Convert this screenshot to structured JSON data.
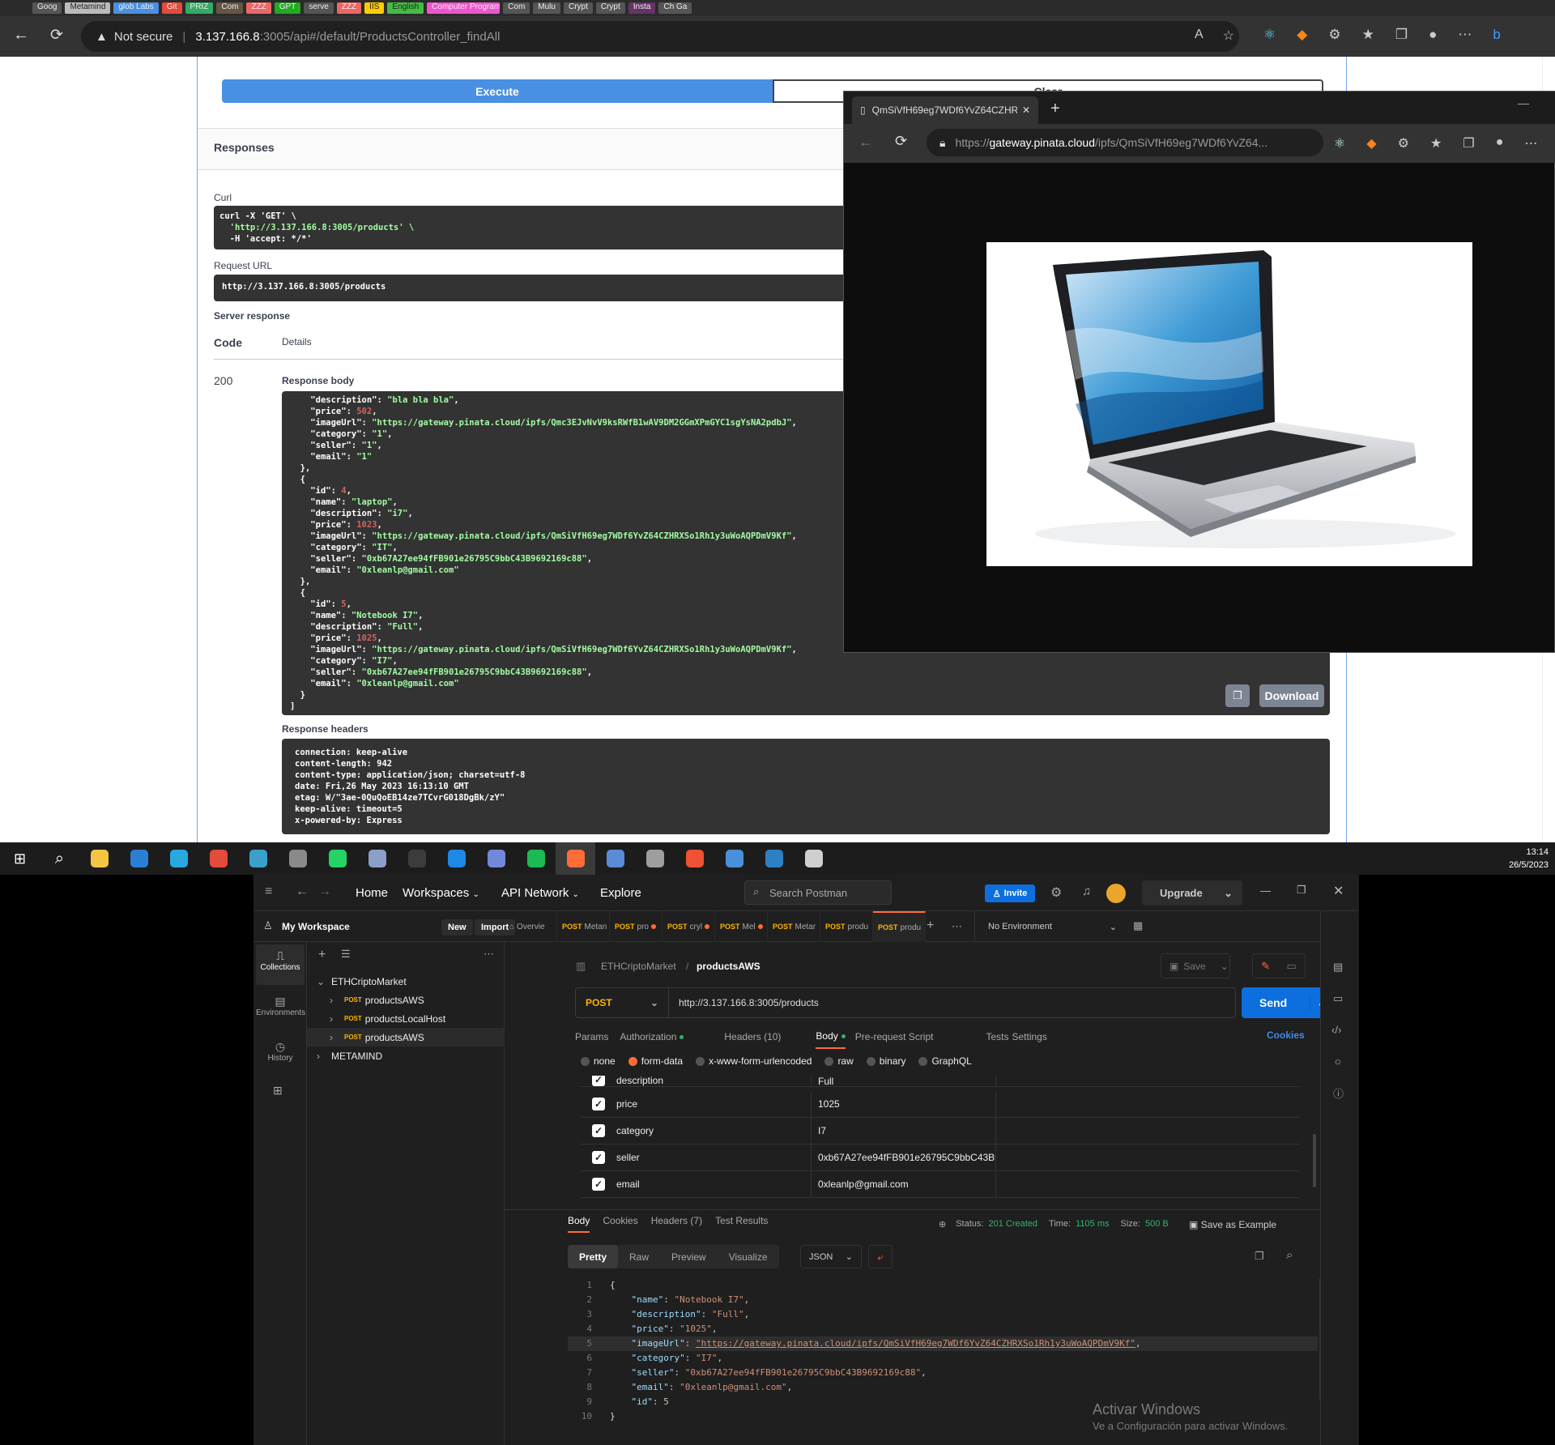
{
  "browser": {
    "tabs": [
      "Goog",
      "Metamind",
      "glob Labs",
      "Git",
      "PRIZ",
      "Com",
      "ZZZ",
      "GPT",
      "serve",
      "ZZZ",
      "IIS",
      "English",
      "Computer Program",
      "Com",
      "Mulu",
      "Crypt",
      "Crypt",
      "Insta",
      "Ch Ga"
    ],
    "not_secure": "Not secure",
    "url_host": "3.137.166.8",
    "url_rest": ":3005/api#/default/ProductsController_findAll"
  },
  "swagger": {
    "execute": "Execute",
    "clear": "Clear",
    "responses": "Responses",
    "curl_label": "Curl",
    "curl_lines": [
      "curl -X 'GET' \\",
      "  'http://3.137.166.8:3005/products' \\",
      "  -H 'accept: */*'"
    ],
    "request_url_label": "Request URL",
    "request_url": "http://3.137.166.8:3005/products",
    "server_response": "Server response",
    "code_hdr": "Code",
    "details_hdr": "Details",
    "code": "200",
    "response_body_label": "Response body",
    "body_lines": [
      [
        "    ",
        [
          "k",
          "\"description\""
        ],
        ": ",
        [
          "s",
          "\"bla bla bla\""
        ],
        ","
      ],
      [
        "    ",
        [
          "k",
          "\"price\""
        ],
        ": ",
        [
          "n",
          "502"
        ],
        ","
      ],
      [
        "    ",
        [
          "k",
          "\"imageUrl\""
        ],
        ": ",
        [
          "s",
          "\"https://gateway.pinata.cloud/ipfs/Qmc3EJvNvV9ksRWfB1wAV9DM2GGmXPmGYC1sgYsNA2pdbJ\""
        ],
        ","
      ],
      [
        "    ",
        [
          "k",
          "\"category\""
        ],
        ": ",
        [
          "s",
          "\"1\""
        ],
        ","
      ],
      [
        "    ",
        [
          "k",
          "\"seller\""
        ],
        ": ",
        [
          "s",
          "\"1\""
        ],
        ","
      ],
      [
        "    ",
        [
          "k",
          "\"email\""
        ],
        ": ",
        [
          "s",
          "\"1\""
        ]
      ],
      [
        "  },"
      ],
      [
        "  {"
      ],
      [
        "    ",
        [
          "k",
          "\"id\""
        ],
        ": ",
        [
          "n",
          "4"
        ],
        ","
      ],
      [
        "    ",
        [
          "k",
          "\"name\""
        ],
        ": ",
        [
          "s",
          "\"laptop\""
        ],
        ","
      ],
      [
        "    ",
        [
          "k",
          "\"description\""
        ],
        ": ",
        [
          "s",
          "\"i7\""
        ],
        ","
      ],
      [
        "    ",
        [
          "k",
          "\"price\""
        ],
        ": ",
        [
          "n",
          "1023"
        ],
        ","
      ],
      [
        "    ",
        [
          "k",
          "\"imageUrl\""
        ],
        ": ",
        [
          "s",
          "\"https://gateway.pinata.cloud/ipfs/QmSiVfH69eg7WDf6YvZ64CZHRXSo1Rh1y3uWoAQPDmV9Kf\""
        ],
        ","
      ],
      [
        "    ",
        [
          "k",
          "\"category\""
        ],
        ": ",
        [
          "s",
          "\"IT\""
        ],
        ","
      ],
      [
        "    ",
        [
          "k",
          "\"seller\""
        ],
        ": ",
        [
          "s",
          "\"0xb67A27ee94fFB901e26795C9bbC43B9692169c88\""
        ],
        ","
      ],
      [
        "    ",
        [
          "k",
          "\"email\""
        ],
        ": ",
        [
          "s",
          "\"0xleanlp@gmail.com\""
        ]
      ],
      [
        "  },"
      ],
      [
        "  {"
      ],
      [
        "    ",
        [
          "k",
          "\"id\""
        ],
        ": ",
        [
          "n",
          "5"
        ],
        ","
      ],
      [
        "    ",
        [
          "k",
          "\"name\""
        ],
        ": ",
        [
          "s",
          "\"Notebook I7\""
        ],
        ","
      ],
      [
        "    ",
        [
          "k",
          "\"description\""
        ],
        ": ",
        [
          "s",
          "\"Full\""
        ],
        ","
      ],
      [
        "    ",
        [
          "k",
          "\"price\""
        ],
        ": ",
        [
          "n",
          "1025"
        ],
        ","
      ],
      [
        "    ",
        [
          "k",
          "\"imageUrl\""
        ],
        ": ",
        [
          "s",
          "\"https://gateway.pinata.cloud/ipfs/QmSiVfH69eg7WDf6YvZ64CZHRXSo1Rh1y3uWoAQPDmV9Kf\""
        ],
        ","
      ],
      [
        "    ",
        [
          "k",
          "\"category\""
        ],
        ": ",
        [
          "s",
          "\"I7\""
        ],
        ","
      ],
      [
        "    ",
        [
          "k",
          "\"seller\""
        ],
        ": ",
        [
          "s",
          "\"0xb67A27ee94fFB901e26795C9bbC43B9692169c88\""
        ],
        ","
      ],
      [
        "    ",
        [
          "k",
          "\"email\""
        ],
        ": ",
        [
          "s",
          "\"0xleanlp@gmail.com\""
        ]
      ],
      [
        "  }"
      ],
      [
        "]"
      ]
    ],
    "download": "Download",
    "response_headers_label": "Response headers",
    "headers_lines": [
      "connection: keep-alive",
      "content-length: 942",
      "content-type: application/json; charset=utf-8",
      "date: Fri,26 May 2023 16:13:10 GMT",
      "etag: W/\"3ae-0QuQoEB14ze7TCvrG018DgBk/zY\"",
      "keep-alive: timeout=5",
      "x-powered-by: Express"
    ]
  },
  "pinata": {
    "tab_title": "QmSiVfH69eg7WDf6YvZ64CZHR",
    "url_prefix": "https://",
    "url_host": "gateway.pinata.cloud",
    "url_rest": "/ipfs/QmSiVfH69eg7WDf6YvZ64..."
  },
  "taskbar": {
    "time": "13:14",
    "date": "26/5/2023",
    "icons": [
      "#f4c542",
      "#2a7fd4",
      "#2aa8e0",
      "#e34b3b",
      "#3aa0c9",
      "#8a8a8a",
      "#25d366",
      "#8aa0c8",
      "#3c3c3c",
      "#1e88e5",
      "#7289da",
      "#1db954",
      "#ff6c37",
      "#5b8bd6",
      "#9e9e9e",
      "#f05033",
      "#4a90d9",
      "#2f80c2",
      "#cfcfcf"
    ]
  },
  "postman": {
    "nav": {
      "home": "Home",
      "workspaces": "Workspaces",
      "api_network": "API Network",
      "explore": "Explore",
      "search": "Search Postman",
      "invite": "Invite",
      "upgrade": "Upgrade"
    },
    "workspace": "My Workspace",
    "new": "New",
    "import": "Import",
    "sidebar": [
      "Collections",
      "Environments",
      "History"
    ],
    "tree": {
      "root": "ETHCriptoMarket",
      "items": [
        "productsAWS",
        "productsLocalHost",
        "productsAWS"
      ],
      "other": "METAMIND",
      "method": "POST"
    },
    "tabs": [
      [
        "",
        "Overvie"
      ],
      [
        "POST",
        "Metan"
      ],
      [
        "POST",
        "pro"
      ],
      [
        "POST",
        "cryl"
      ],
      [
        "POST",
        "Mel"
      ],
      [
        "POST",
        "Metar"
      ],
      [
        "POST",
        "produ"
      ],
      [
        "POST",
        "produ"
      ]
    ],
    "env": "No Environment",
    "breadcrumb": {
      "collection": "ETHCriptoMarket",
      "sep": "/",
      "request": "productsAWS"
    },
    "save": "Save",
    "method": "POST",
    "url": "http://3.137.166.8:3005/products",
    "send": "Send",
    "req_tabs": [
      "Params",
      "Authorization",
      "Headers (10)",
      "Body",
      "Pre-request Script",
      "Tests",
      "Settings"
    ],
    "cookies": "Cookies",
    "body_types": [
      "none",
      "form-data",
      "x-www-form-urlencoded",
      "raw",
      "binary",
      "GraphQL"
    ],
    "form_rows": [
      [
        "description",
        "Full"
      ],
      [
        "price",
        "1025"
      ],
      [
        "category",
        "I7"
      ],
      [
        "seller",
        "0xb67A27ee94fFB901e26795C9bbC43B969..."
      ],
      [
        "email",
        "0xleanlp@gmail.com"
      ]
    ],
    "resp_tabs": [
      "Body",
      "Cookies",
      "Headers (7)",
      "Test Results"
    ],
    "status_label": "Status:",
    "status": "201 Created",
    "time_label": "Time:",
    "time": "1105 ms",
    "size_label": "Size:",
    "size": "500 B",
    "save_example": "Save as Example",
    "view_tabs": [
      "Pretty",
      "Raw",
      "Preview",
      "Visualize"
    ],
    "format": "JSON",
    "resp_lines": [
      [
        [
          "p",
          "{"
        ]
      ],
      [
        "    ",
        [
          "k",
          "\"name\""
        ],
        ": ",
        [
          "s",
          "\"Notebook I7\""
        ],
        ","
      ],
      [
        "    ",
        [
          "k",
          "\"description\""
        ],
        ": ",
        [
          "s",
          "\"Full\""
        ],
        ","
      ],
      [
        "    ",
        [
          "k",
          "\"price\""
        ],
        ": ",
        [
          "s",
          "\"1025\""
        ],
        ","
      ],
      [
        "    ",
        [
          "k",
          "\"imageUrl\""
        ],
        ": ",
        [
          "u",
          "\"https://gateway.pinata.cloud/ipfs/QmSiVfH69eg7WDf6YvZ64CZHRXSo1Rh1y3uWoAQPDmV9Kf\""
        ],
        ","
      ],
      [
        "    ",
        [
          "k",
          "\"category\""
        ],
        ": ",
        [
          "s",
          "\"I7\""
        ],
        ","
      ],
      [
        "    ",
        [
          "k",
          "\"seller\""
        ],
        ": ",
        [
          "s",
          "\"0xb67A27ee94fFB901e26795C9bbC43B9692169c88\""
        ],
        ","
      ],
      [
        "    ",
        [
          "k",
          "\"email\""
        ],
        ": ",
        [
          "s",
          "\"0xleanlp@gmail.com\""
        ],
        ","
      ],
      [
        "    ",
        [
          "k",
          "\"id\""
        ],
        ": ",
        [
          "n",
          "5"
        ]
      ],
      [
        [
          "p",
          "}"
        ]
      ]
    ],
    "watermark1": "Activar Windows",
    "watermark2": "Ve a Configuración para activar Windows."
  },
  "colors": {
    "swagger_execute": "#4990e2",
    "postman_orange": "#ff6c37",
    "send_blue": "#0d6fde",
    "json_key": "#9cdcfe"
  }
}
